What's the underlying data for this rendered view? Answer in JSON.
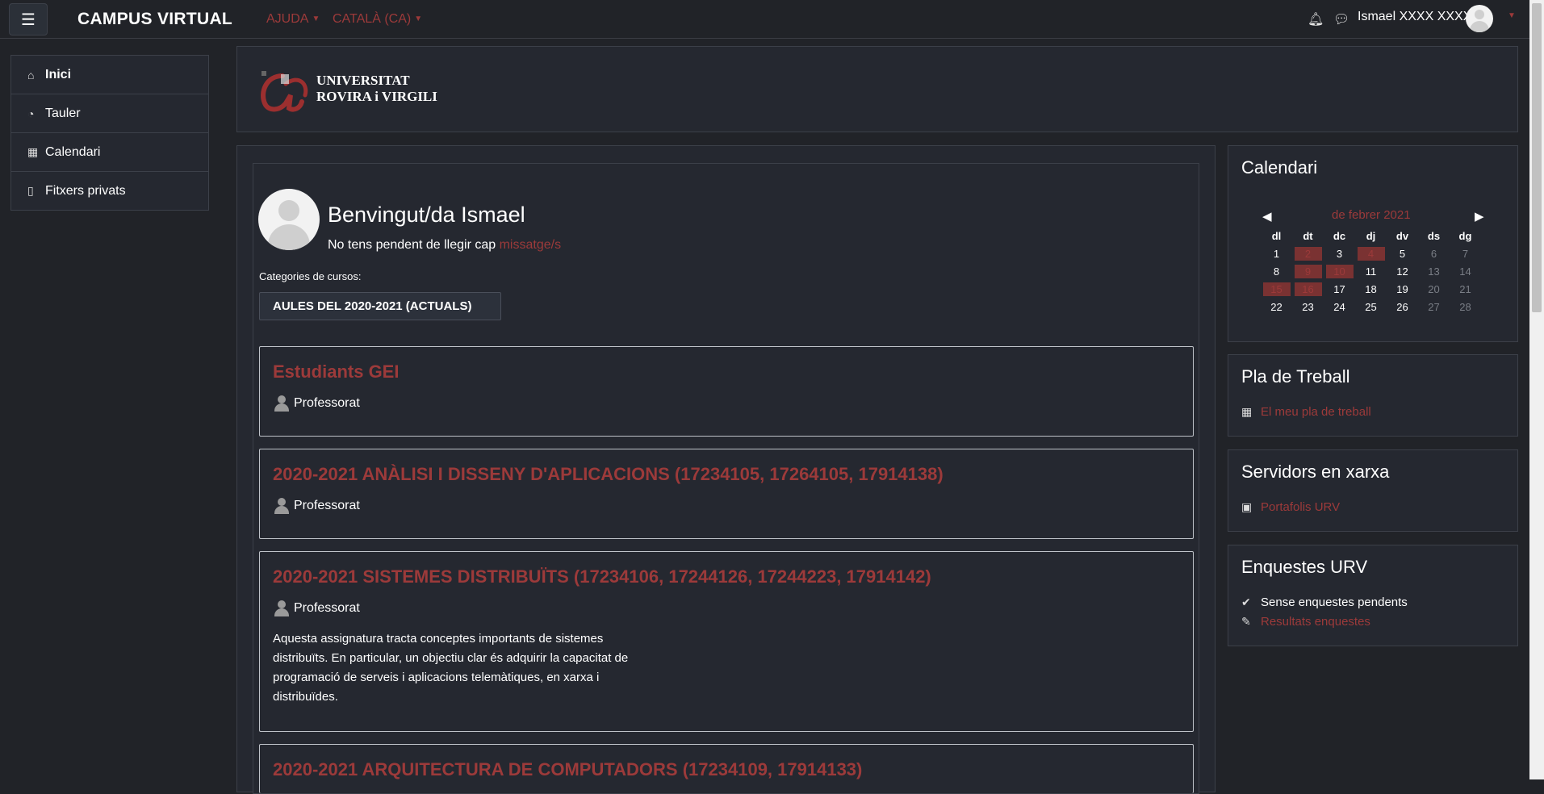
{
  "navbar": {
    "brand": "CAMPUS VIRTUAL",
    "help_menu": "AJUDA",
    "language_menu": "CATALÀ (CA)",
    "user_name": "Ismael XXXX XXXX"
  },
  "nav": {
    "items": [
      {
        "label": "Inici",
        "icon": "home-icon",
        "active": true
      },
      {
        "label": "Tauler",
        "icon": "dashboard-icon"
      },
      {
        "label": "Calendari",
        "icon": "calendar-icon"
      },
      {
        "label": "Fitxers privats",
        "icon": "file-icon"
      }
    ]
  },
  "header": {
    "logo_line1": "UNIVERSITAT",
    "logo_line2": "ROVIRA i VIRGILI"
  },
  "welcome": {
    "title": "Benvingut/da Ismael",
    "messages_prefix": "No tens pendent de llegir cap",
    "messages_link": "missatge/s",
    "categories_label": "Categories de cursos:",
    "category_button": "AULES DEL 2020-2021 (ACTUALS)"
  },
  "courses": [
    {
      "title": "Estudiants GEI",
      "role": "Professorat"
    },
    {
      "title": "2020-2021 ANÀLISI I DISSENY D'APLICACIONS (17234105, 17264105, 17914138)",
      "role": "Professorat"
    },
    {
      "title": "2020-2021 SISTEMES DISTRIBUÏTS (17234106, 17244126, 17244223, 17914142)",
      "role": "Professorat",
      "description": "Aquesta assignatura tracta conceptes importants de sistemes distribuïts. En particular, un objectiu clar és adquirir la capacitat de programació de serveis i aplicacions telemàtiques, en xarxa i distribuïdes."
    },
    {
      "title": "2020-2021 ARQUITECTURA DE COMPUTADORS (17234109, 17914133)"
    }
  ],
  "calendar": {
    "title": "Calendari",
    "prev": "◀",
    "next": "▶",
    "month": "de febrer 2021",
    "weekdays": [
      "dl",
      "dt",
      "dc",
      "dj",
      "dv",
      "ds",
      "dg"
    ],
    "weeks": [
      [
        "1",
        "2",
        "3",
        "4",
        "5",
        "6",
        "7"
      ],
      [
        "8",
        "9",
        "10",
        "11",
        "12",
        "13",
        "14"
      ],
      [
        "15",
        "16",
        "17",
        "18",
        "19",
        "20",
        "21"
      ],
      [
        "22",
        "23",
        "24",
        "25",
        "26",
        "27",
        "28"
      ]
    ],
    "event_days": [
      "2",
      "4",
      "9",
      "10",
      "15",
      "16"
    ]
  },
  "work_plan": {
    "title": "Pla de Treball",
    "link": "El meu pla de treball"
  },
  "servers": {
    "title": "Servidors en xarxa",
    "link": "Portafolis URV"
  },
  "surveys": {
    "title": "Enquestes URV",
    "status": "Sense enquestes pendents",
    "link": "Resultats enquestes"
  }
}
